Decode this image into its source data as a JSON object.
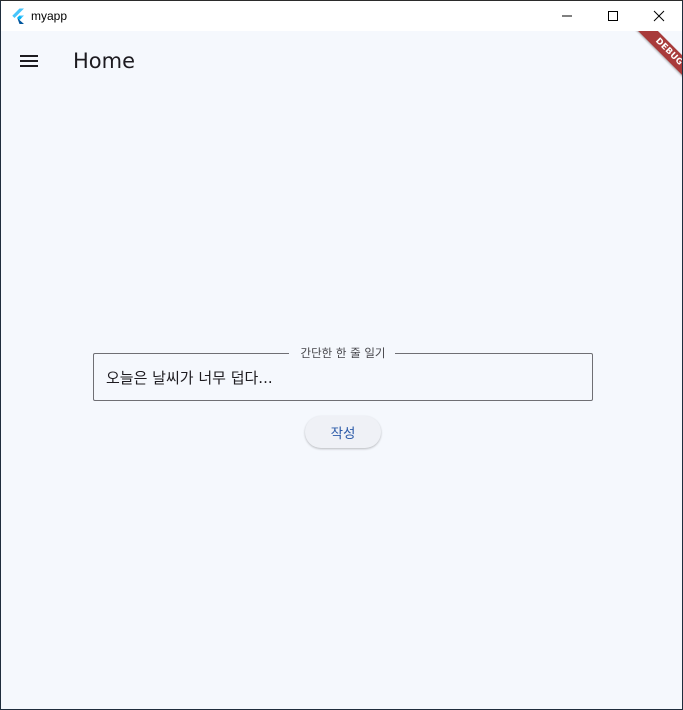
{
  "window": {
    "title": "myapp"
  },
  "appbar": {
    "title": "Home",
    "menu_icon": "hamburger-menu-icon"
  },
  "debug_banner": {
    "label": "DEBUG",
    "color": "#a83b3b"
  },
  "form": {
    "field_label": "간단한 한 줄 일기",
    "field_value": "오늘은 날씨가 너무 덥다...",
    "submit_label": "작성"
  },
  "colors": {
    "background": "#f5f8fd",
    "accent": "#2b5aa8"
  }
}
